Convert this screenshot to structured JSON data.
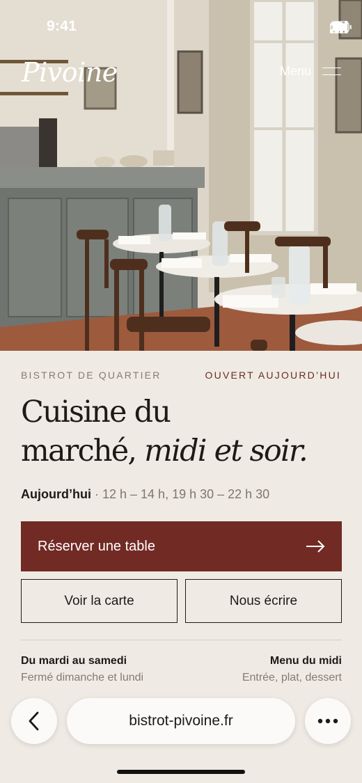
{
  "status_bar": {
    "time": "9:41"
  },
  "header": {
    "logo": "Pivoine",
    "menu_label": "Menu"
  },
  "intro": {
    "tag_left": "BISTROT DE QUARTIER",
    "tag_right": "OUVERT AUJOURD’HUI"
  },
  "headline": {
    "line1": "Cuisine du",
    "line2_regular": "marché, ",
    "line2_italic": "midi et soir."
  },
  "hours": {
    "label": "Aujourd’hui",
    "separator": " · ",
    "value": "12 h – 14 h, 19 h 30 – 22 h 30"
  },
  "actions": {
    "primary": "Réserver une table",
    "secondary_1": "Voir la carte",
    "secondary_2": "Nous écrire"
  },
  "info": {
    "left_title": "Du mardi au samedi",
    "left_sub": "Fermé dimanche et lundi",
    "right_title": "Menu du midi",
    "right_sub": "Entrée, plat, dessert"
  },
  "browser": {
    "url": "bistrot-pivoine.fr"
  },
  "colors": {
    "accent": "#722a25",
    "background": "#efebe4",
    "text": "#1d1a17",
    "muted": "#857a6f"
  }
}
